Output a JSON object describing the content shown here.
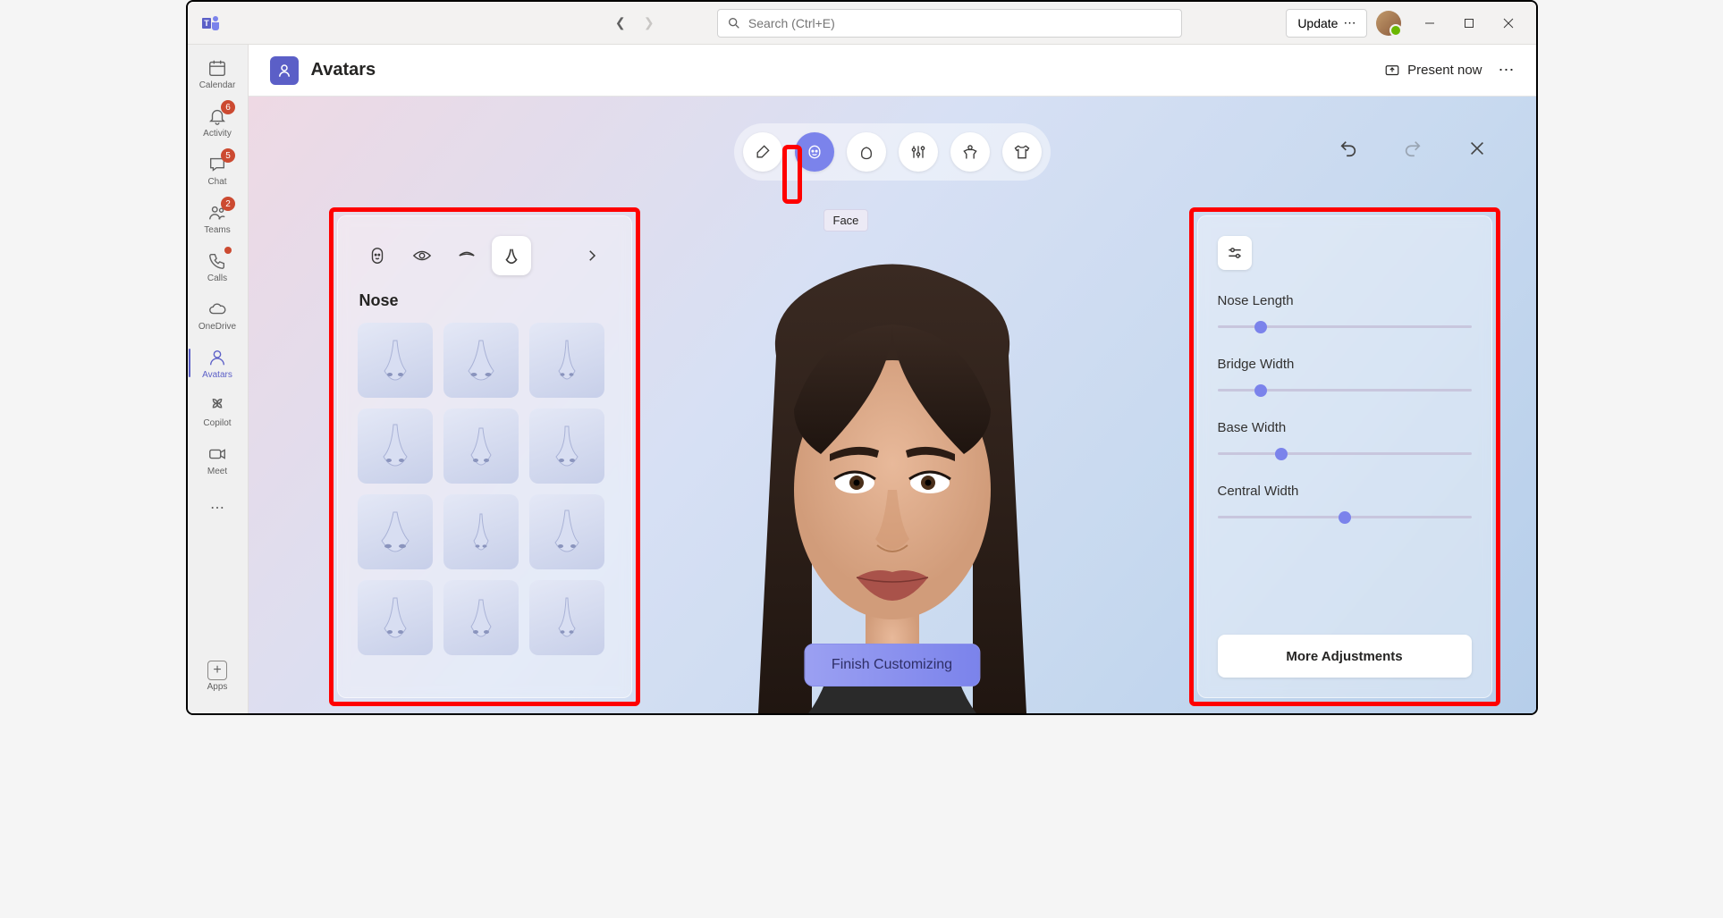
{
  "titlebar": {
    "search_placeholder": "Search (Ctrl+E)",
    "update_label": "Update"
  },
  "rail": {
    "items": [
      {
        "label": "Calendar",
        "icon": "calendar",
        "badge": null,
        "dot": false
      },
      {
        "label": "Activity",
        "icon": "bell",
        "badge": "6",
        "dot": false
      },
      {
        "label": "Chat",
        "icon": "chat",
        "badge": "5",
        "dot": false
      },
      {
        "label": "Teams",
        "icon": "teams",
        "badge": "2",
        "dot": false
      },
      {
        "label": "Calls",
        "icon": "phone",
        "badge": null,
        "dot": true
      },
      {
        "label": "OneDrive",
        "icon": "cloud",
        "badge": null,
        "dot": false
      },
      {
        "label": "Avatars",
        "icon": "avatar",
        "badge": null,
        "dot": false,
        "active": true
      },
      {
        "label": "Copilot",
        "icon": "copilot",
        "badge": null,
        "dot": false
      },
      {
        "label": "Meet",
        "icon": "meet",
        "badge": null,
        "dot": false
      }
    ],
    "apps_label": "Apps"
  },
  "header": {
    "title": "Avatars",
    "present_label": "Present now"
  },
  "categories": {
    "items": [
      "brush",
      "face",
      "hair",
      "sliders",
      "body",
      "wardrobe"
    ],
    "active_index": 1,
    "tooltip": "Face"
  },
  "face_tabs": {
    "items": [
      "face-shape",
      "eyes",
      "eyebrows",
      "nose"
    ],
    "active_index": 3
  },
  "nose_panel": {
    "title": "Nose",
    "options_count": 12
  },
  "sliders": {
    "items": [
      {
        "label": "Nose Length",
        "value": 17
      },
      {
        "label": "Bridge Width",
        "value": 17
      },
      {
        "label": "Base Width",
        "value": 25
      },
      {
        "label": "Central Width",
        "value": 50
      }
    ],
    "more_label": "More Adjustments"
  },
  "finish_label": "Finish Customizing"
}
